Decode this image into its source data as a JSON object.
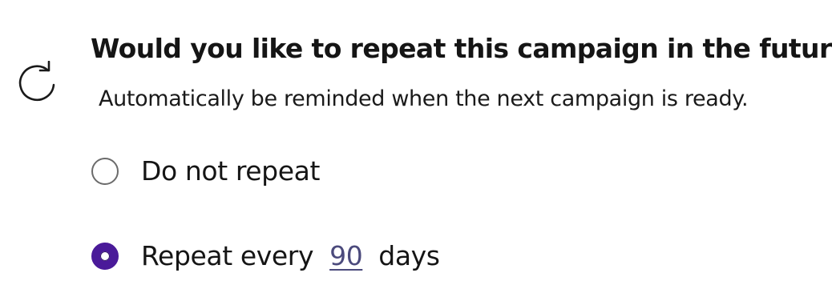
{
  "question": {
    "title": "Would you like to repeat this campaign in the future?",
    "subtitle": "Automatically be reminded when the next campaign is ready.",
    "icon": "repeat-icon"
  },
  "options": [
    {
      "label": "Do not repeat",
      "selected": false
    },
    {
      "label": "Repeat every",
      "selected": true,
      "interval_value": "90",
      "interval_unit": "days"
    }
  ],
  "colors": {
    "accent": "#4a1a99",
    "input_text": "#4b4a7c",
    "radio_border": "#6b6b6b"
  }
}
